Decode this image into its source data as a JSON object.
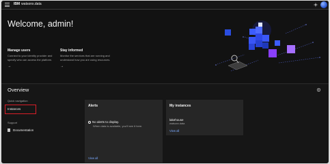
{
  "header": {
    "brand_ibm": "IBM",
    "brand_product": "watsonx.data",
    "menu_icon": "hamburger-menu-icon",
    "notification_icon": "sparkle-icon"
  },
  "hero": {
    "title": "Welcome, admin!",
    "cards": [
      {
        "heading": "Manage users",
        "description": "Connect to your identity provider and specify who can access the platform.",
        "arrow": "→"
      },
      {
        "heading": "Stay informed",
        "description": "Monitor the services that are running and understand how you are using resources.",
        "arrow": "→"
      }
    ]
  },
  "overview": {
    "title": "Overview",
    "quick_nav_label": "Quick navigation",
    "instances_label": "Instances",
    "support_label": "Support",
    "documentation_label": "Documentation"
  },
  "alerts": {
    "title": "Alerts",
    "empty_title": "No alerts to display.",
    "empty_subtitle": "When data is available, you'll see it here.",
    "view_all": "View all"
  },
  "my_instances": {
    "title": "My instances",
    "items": [
      {
        "name": "lakehouse",
        "type": "watsonx.data"
      }
    ],
    "view_all": "View all"
  },
  "colors": {
    "background": "#161616",
    "tile": "#262626",
    "link": "#78a9ff",
    "highlight": "#da1e28"
  }
}
